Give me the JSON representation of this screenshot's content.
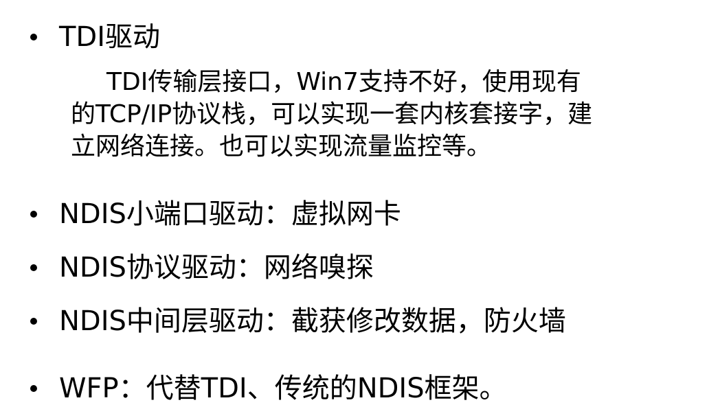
{
  "bullets": [
    {
      "id": "tdi",
      "text": "TDI驱动",
      "details": [
        "TDI传输层接口，Win7支持不好，使用现有",
        "的TCP/IP协议栈，可以实现一套内核套接字，建",
        "立网络连接。也可以实现流量监控等。"
      ]
    },
    {
      "id": "ndis-miniport",
      "text": "NDIS小端口驱动：虚拟网卡"
    },
    {
      "id": "ndis-protocol",
      "text": "NDIS协议驱动：网络嗅探"
    },
    {
      "id": "ndis-intermediate",
      "text": "NDIS中间层驱动：截获修改数据，防火墙"
    },
    {
      "id": "wfp",
      "text": "WFP：代替TDI、传统的NDIS框架。"
    }
  ]
}
